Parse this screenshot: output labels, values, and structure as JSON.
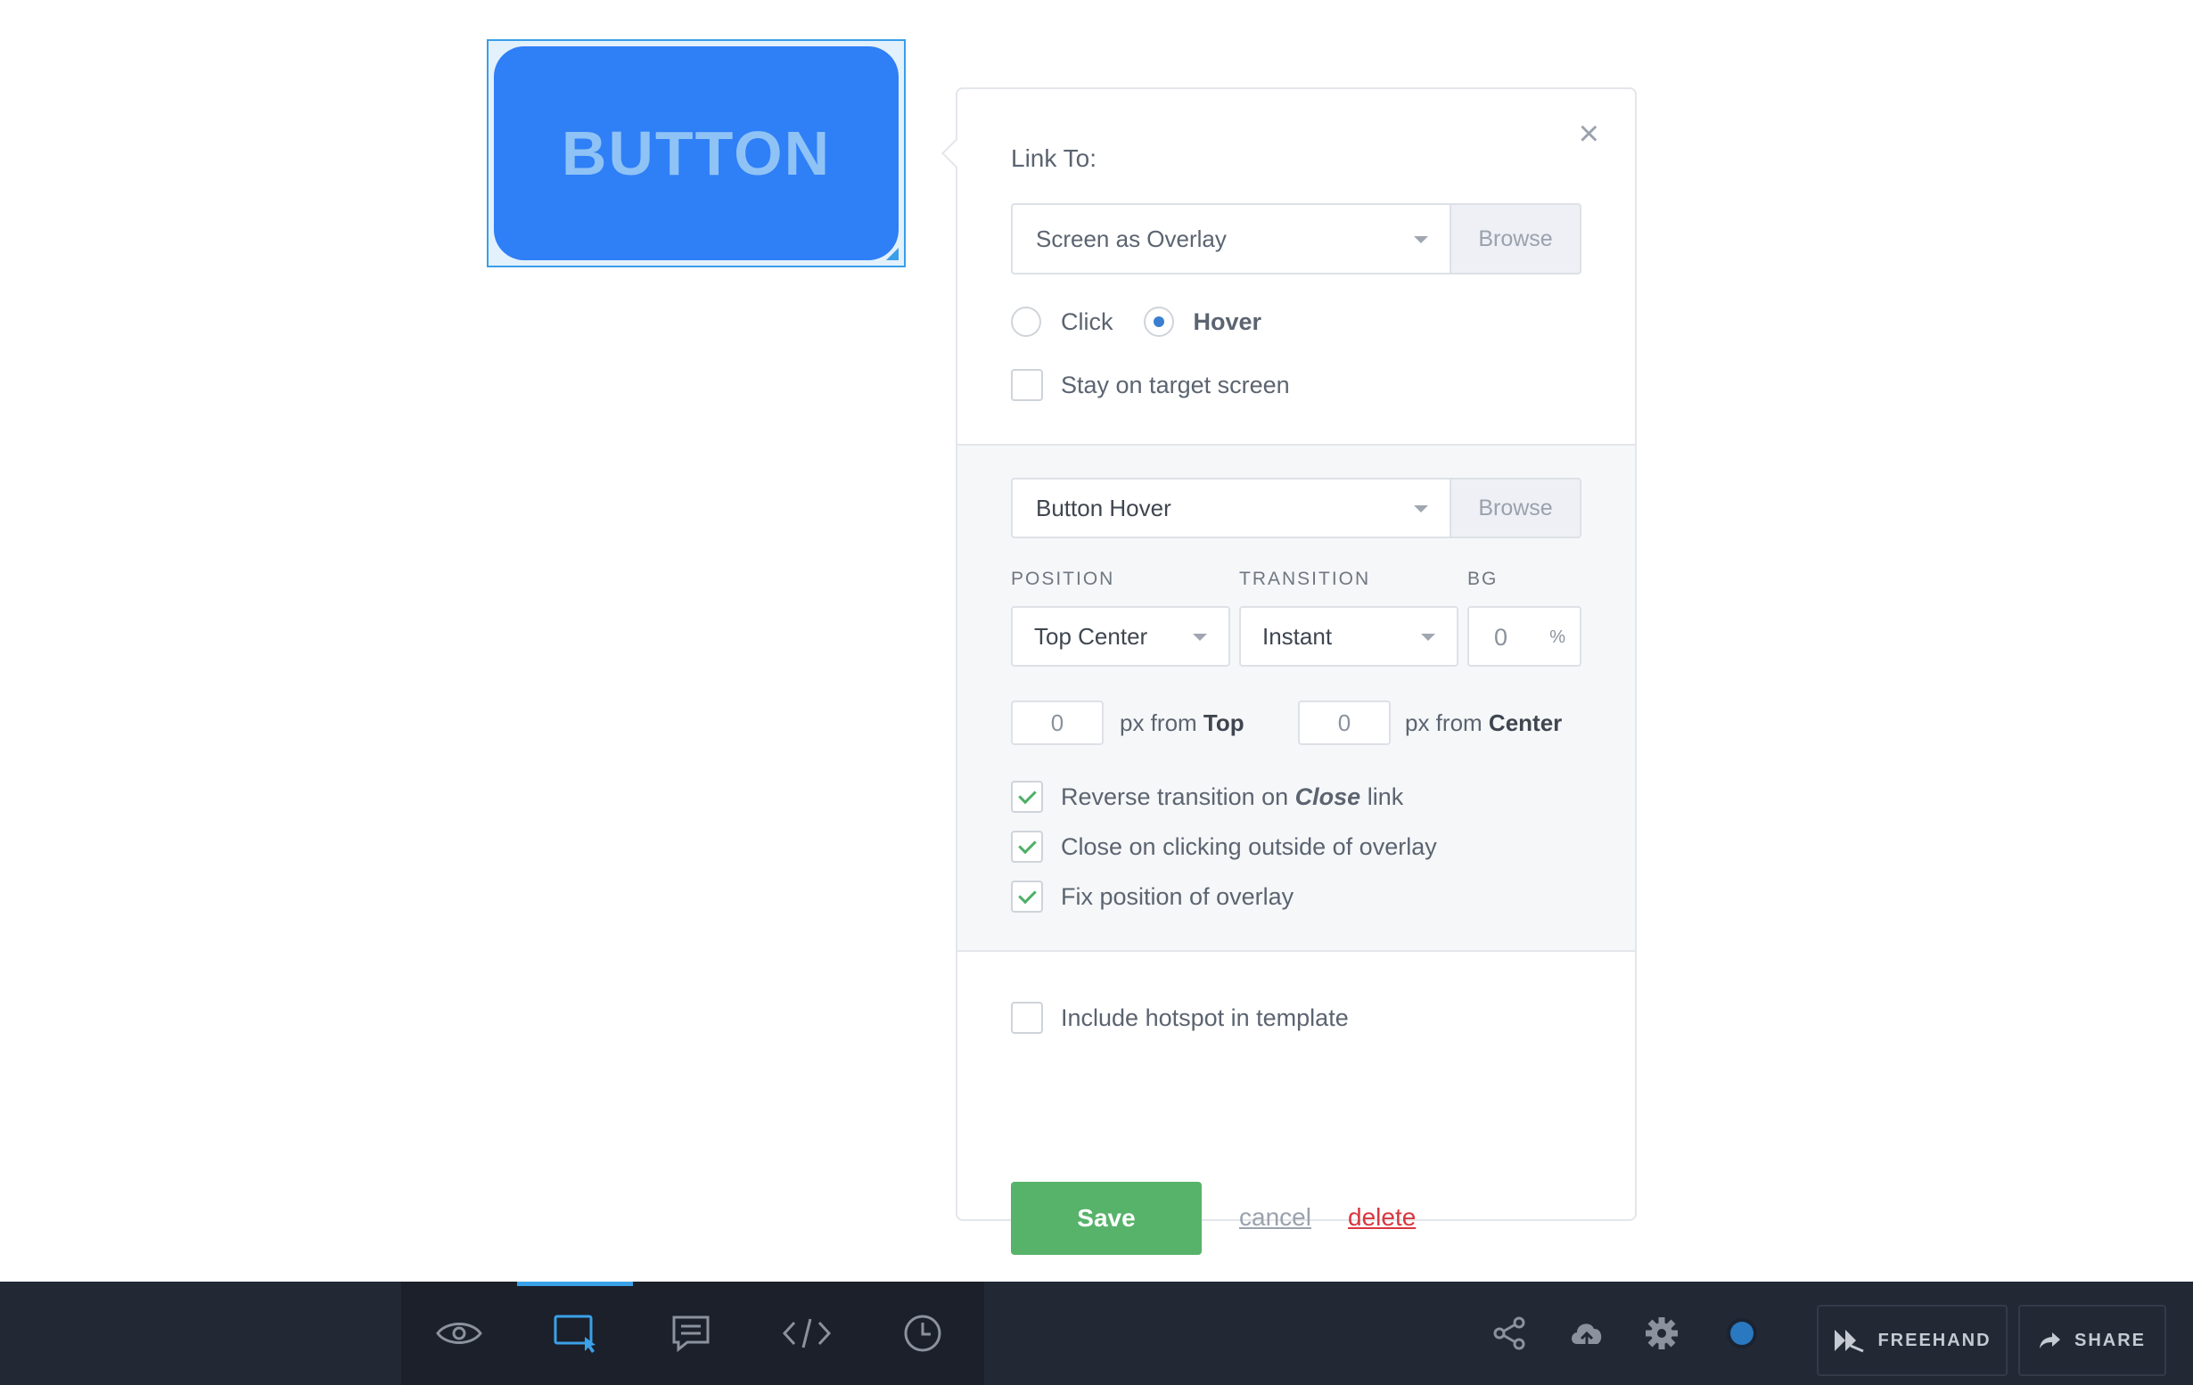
{
  "canvas": {
    "hotspot_button_text": "BUTTON"
  },
  "panel": {
    "title": "Link To:",
    "link_type": {
      "value": "Screen as Overlay",
      "browse_label": "Browse"
    },
    "trigger": {
      "options": [
        {
          "label": "Click",
          "selected": false
        },
        {
          "label": "Hover",
          "selected": true
        }
      ]
    },
    "stay_on_target": {
      "label": "Stay on target screen",
      "checked": false
    },
    "overlay": {
      "screen_value": "Button Hover",
      "browse_label": "Browse",
      "position_label": "POSITION",
      "position_value": "Top Center",
      "transition_label": "TRANSITION",
      "transition_value": "Instant",
      "bg_label": "BG",
      "bg_value": "0",
      "bg_unit": "%",
      "offset_top_value": "0",
      "offset_top_text": "px from",
      "offset_top_anchor": "Top",
      "offset_center_value": "0",
      "offset_center_text": "px from",
      "offset_center_anchor": "Center",
      "options": {
        "reverse_prefix": "Reverse transition on",
        "reverse_emph": "Close",
        "reverse_suffix": "link",
        "reverse_checked": true,
        "close_outside": "Close on clicking outside of overlay",
        "close_outside_checked": true,
        "fix_position": "Fix position of overlay",
        "fix_position_checked": true
      }
    },
    "include_template": {
      "label": "Include hotspot in template",
      "checked": false
    },
    "actions": {
      "save": "Save",
      "cancel": "cancel",
      "delete": "delete"
    }
  },
  "bottombar": {
    "tools": [
      {
        "name": "preview",
        "icon": "eye-icon",
        "active": false
      },
      {
        "name": "hotspot",
        "icon": "hotspot-icon",
        "active": true
      },
      {
        "name": "comments",
        "icon": "comment-icon",
        "active": false
      },
      {
        "name": "code",
        "icon": "code-icon",
        "active": false
      },
      {
        "name": "history",
        "icon": "clock-icon",
        "active": false
      }
    ],
    "freehand_label": "FREEHAND",
    "share_label": "SHARE"
  },
  "colors": {
    "accent": "#3ba1e8",
    "save_green": "#57b36a",
    "delete_red": "#d9363e",
    "hotspot_blue": "#2f7ff6",
    "bar_bg": "#222834"
  }
}
